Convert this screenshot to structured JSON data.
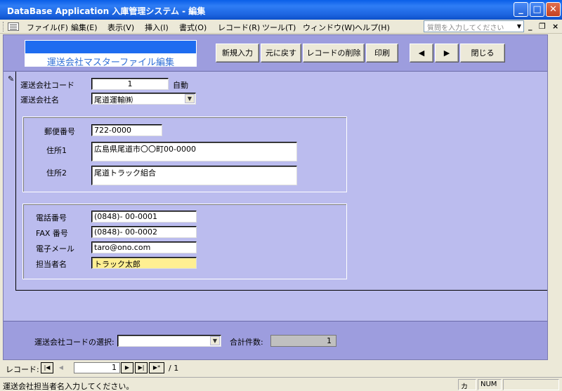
{
  "window": {
    "title": "DataBase Application 入庫管理システム - 編集",
    "minimize": "_",
    "maximize": "□",
    "close": "✕"
  },
  "menu": {
    "items": [
      "ファイル(F)",
      "編集(E)",
      "表示(V)",
      "挿入(I)",
      "書式(O)",
      "レコード(R)",
      "ツール(T)",
      "ウィンドウ(W)",
      "ヘルプ(H)"
    ],
    "ask_placeholder": "質問を入力してください",
    "mdi_min": "_",
    "mdi_restore": "❐",
    "mdi_close": "×"
  },
  "header": {
    "form_title": "運送会社マスターファイル編集",
    "buttons": {
      "new": "新規入力",
      "undo": "元に戻す",
      "delete": "レコードの削除",
      "print": "印刷",
      "prev": "◀",
      "next": "▶",
      "close": "閉じる"
    }
  },
  "fields": {
    "code_label": "運送会社コード",
    "code_value": "1",
    "code_note": "自動",
    "name_label": "運送会社名",
    "name_value": "尾道運輸㈱",
    "postal_label": "郵便番号",
    "postal_value": "722-0000",
    "addr1_label": "住所1",
    "addr1_value": "広島県尾道市〇〇町00-0000",
    "addr2_label": "住所2",
    "addr2_value": "尾道トラック組合",
    "tel_label": "電話番号",
    "tel_value": "(0848)-  00-0001",
    "fax_label": "FAX 番号",
    "fax_value": "(0848)-  00-0002",
    "email_label": "電子メール",
    "email_value": "taro@ono.com",
    "contact_label": "担当者名",
    "contact_value": "トラック太郎"
  },
  "footer": {
    "select_label": "運送会社コードの選択:",
    "select_value": "",
    "total_label": "合計件数:",
    "total_value": "1"
  },
  "navigator": {
    "label": "レコード:",
    "current": "1",
    "of_total": "/ 1"
  },
  "status": {
    "message": "運送会社担当者名入力してください。",
    "kana": "カナ",
    "num": "NUM"
  },
  "colors": {
    "form_bg": "#bbbcee",
    "header_bg": "#9d9dde",
    "highlight_field": "#ffef92",
    "title_bar": "#1c64e0"
  }
}
